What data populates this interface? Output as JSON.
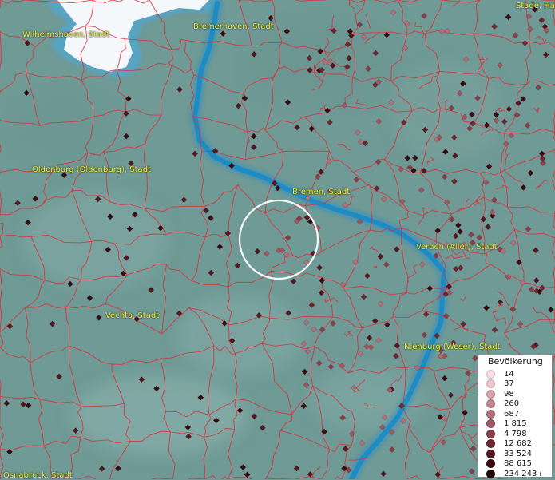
{
  "map": {
    "selection_circle": {
      "present": true
    },
    "cities": [
      {
        "name": "Wilhelmshaven, Stadt"
      },
      {
        "name": "Bremerhaven, Stadt"
      },
      {
        "name": "Stade, Ha"
      },
      {
        "name": "Oldenburg (Oldenburg), Stadt"
      },
      {
        "name": "Bremen, Stadt"
      },
      {
        "name": "Verden (Aller), Stadt"
      },
      {
        "name": "Vechta, Stadt"
      },
      {
        "name": "Nienburg (Weser), Stadt"
      },
      {
        "name": "Osnabrück, Stadt"
      }
    ],
    "colors": {
      "land": "#6f9a96",
      "border": "#e0303a",
      "river": "#1e8cc4",
      "sea": "#f4f8fb",
      "label": "#f0ea2a"
    }
  },
  "legend": {
    "title": "Bevölkerung",
    "items": [
      {
        "label": "14",
        "color": "#f6dde6"
      },
      {
        "label": "37",
        "color": "#eec6d0"
      },
      {
        "label": "98",
        "color": "#d8a1ad"
      },
      {
        "label": "260",
        "color": "#c5838f"
      },
      {
        "label": "687",
        "color": "#b36f79"
      },
      {
        "label": "1 815",
        "color": "#a15561"
      },
      {
        "label": "4 798",
        "color": "#8a3e4a"
      },
      {
        "label": "12 682",
        "color": "#6e2732"
      },
      {
        "label": "33 524",
        "color": "#541720"
      },
      {
        "label": "88 615",
        "color": "#3a0c12"
      },
      {
        "label": "234 243",
        "color": "#1c0407",
        "suffix": "+"
      }
    ]
  }
}
